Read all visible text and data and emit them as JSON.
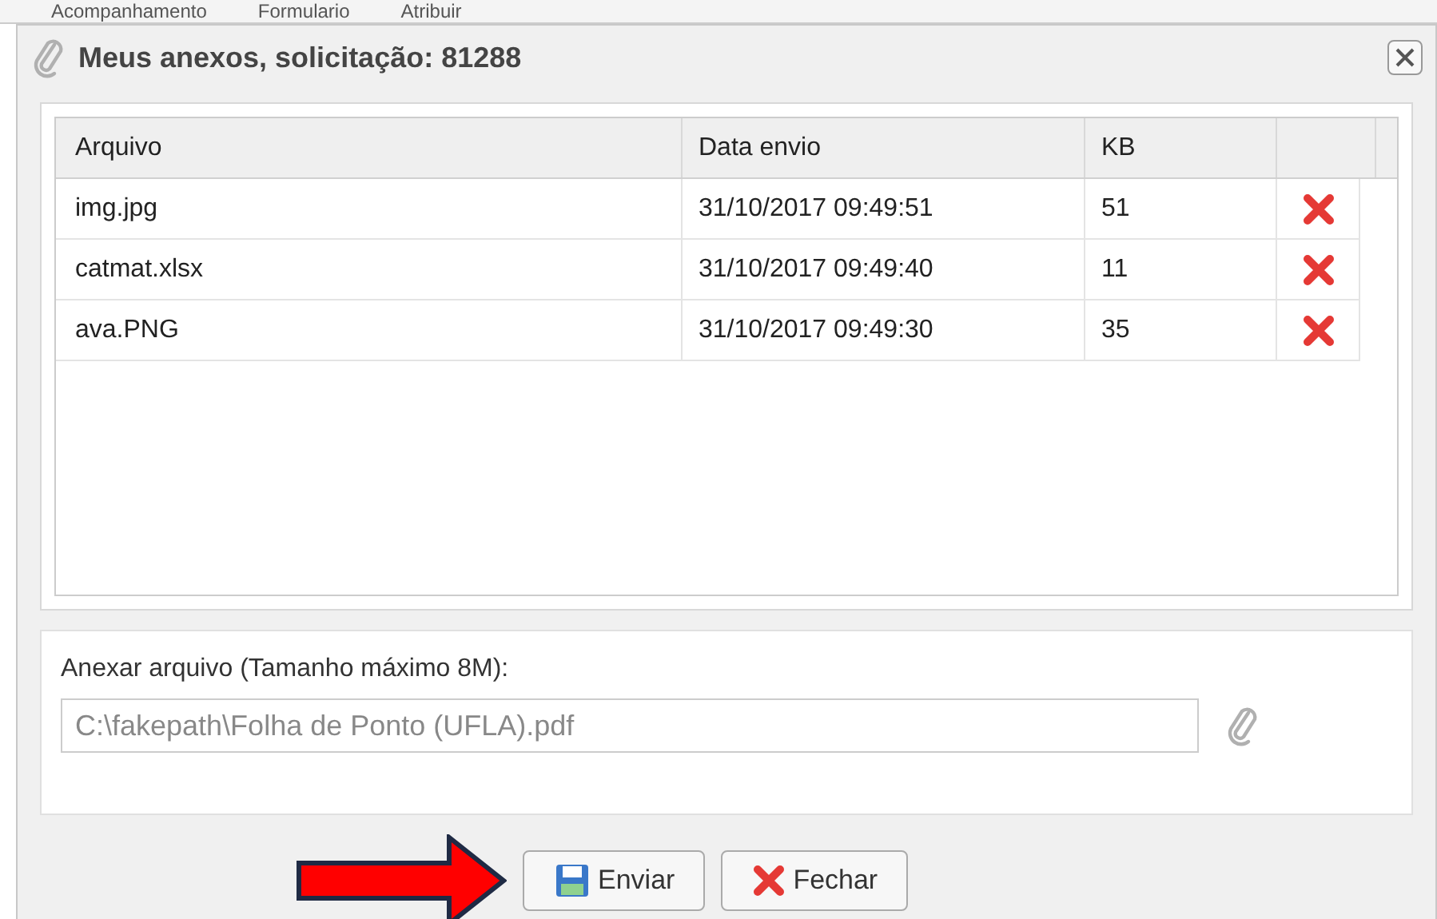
{
  "background_toolbar": [
    "Acompanhamento",
    "Formulario",
    "Atribuir"
  ],
  "window": {
    "title": "Meus anexos, solicitação: 81288"
  },
  "table": {
    "columns": [
      "Arquivo",
      "Data envio",
      "KB"
    ],
    "rows": [
      {
        "arquivo": "img.jpg",
        "data_envio": "31/10/2017 09:49:51",
        "kb": "51"
      },
      {
        "arquivo": "catmat.xlsx",
        "data_envio": "31/10/2017 09:49:40",
        "kb": "11"
      },
      {
        "arquivo": "ava.PNG",
        "data_envio": "31/10/2017 09:49:30",
        "kb": "35"
      }
    ]
  },
  "upload": {
    "label": "Anexar arquivo (Tamanho máximo 8M):",
    "value": "C:\\fakepath\\Folha de Ponto (UFLA).pdf"
  },
  "buttons": [
    {
      "kind": "save",
      "label": "Enviar"
    },
    {
      "kind": "close",
      "label": "Fechar"
    }
  ]
}
